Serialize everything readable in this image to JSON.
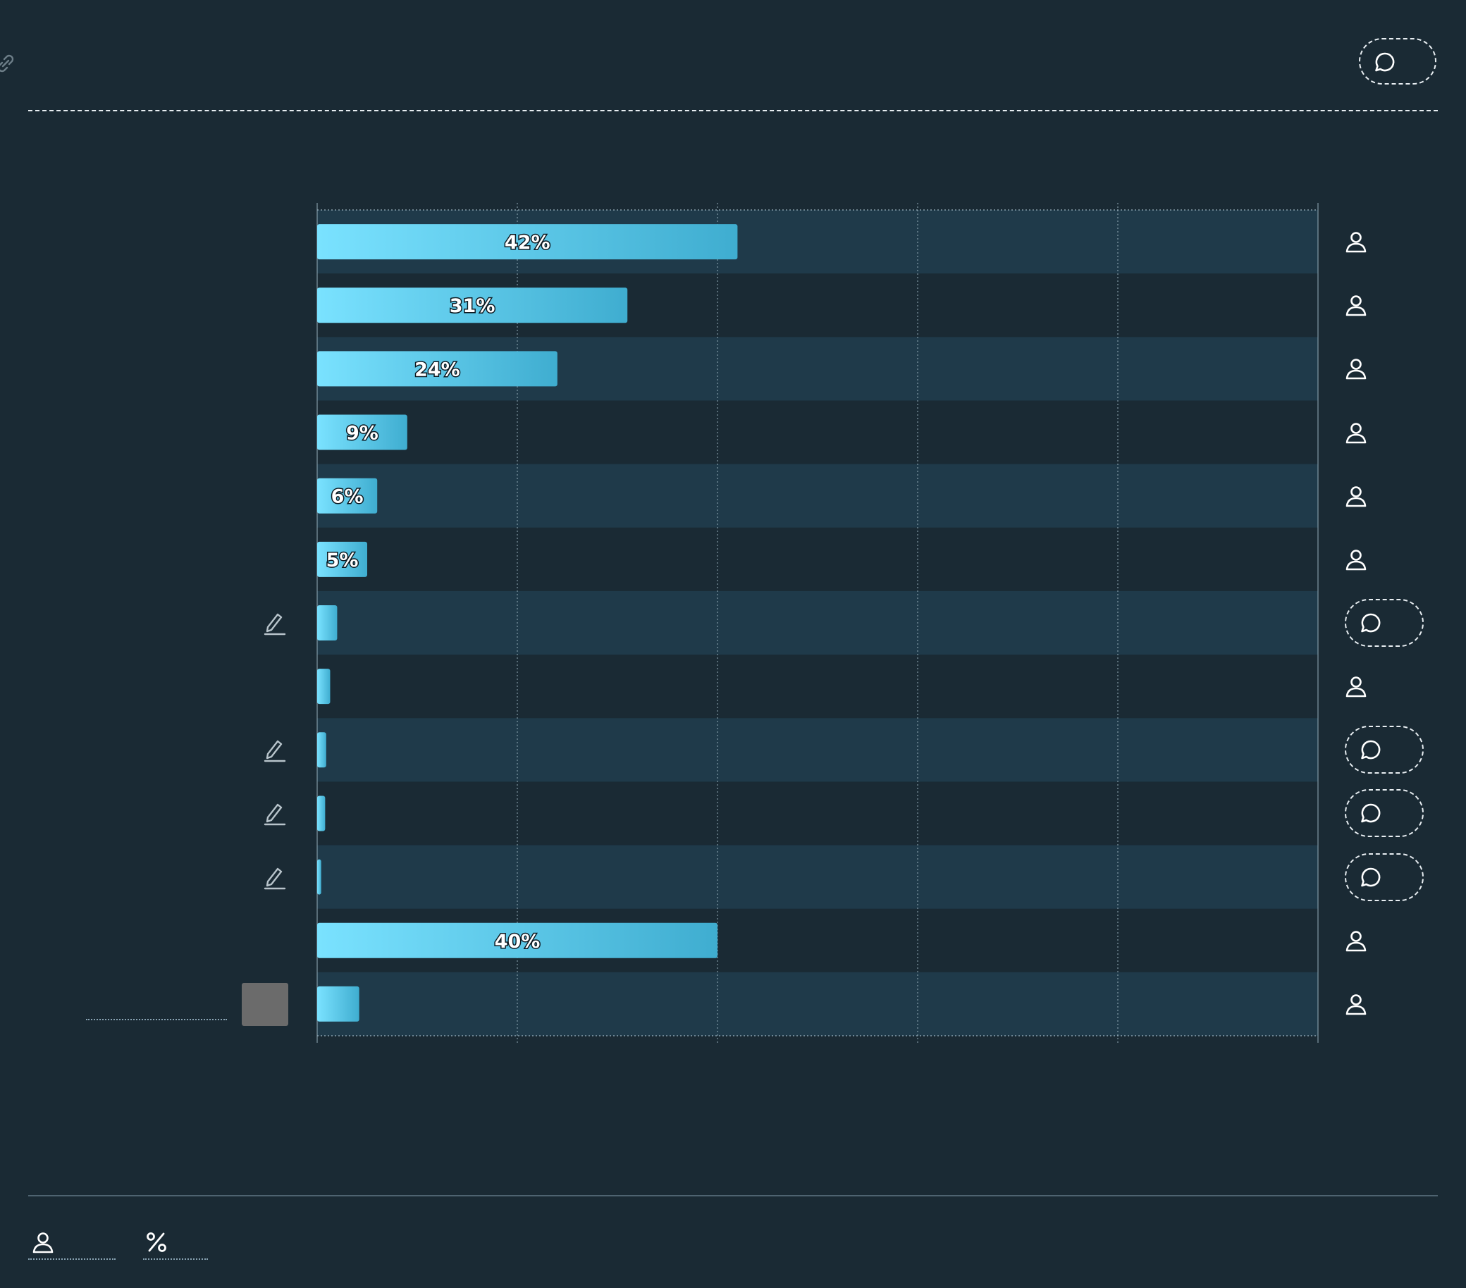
{
  "header": {
    "link_icon": "link-icon",
    "comment_icon": "comment-icon"
  },
  "chart_data": {
    "type": "bar",
    "orientation": "horizontal",
    "values": [
      42,
      31,
      24,
      9,
      6,
      5,
      2,
      1.3,
      0.9,
      0.8,
      0.4,
      40,
      4.2
    ],
    "data_labels": [
      "42%",
      "31%",
      "24%",
      "9%",
      "6%",
      "5%",
      "",
      "",
      "",
      "",
      "",
      "40%",
      ""
    ],
    "row_action_icons": [
      "user-icon",
      "user-icon",
      "user-icon",
      "user-icon",
      "user-icon",
      "user-icon",
      "comment-icon",
      "user-icon",
      "comment-icon",
      "comment-icon",
      "comment-icon",
      "user-icon",
      "user-icon"
    ],
    "row_edit_icons": [
      false,
      false,
      false,
      false,
      false,
      false,
      true,
      false,
      true,
      true,
      true,
      false,
      false
    ],
    "xlim": [
      0,
      100
    ],
    "grid": true,
    "colors": {
      "bar_start": "#7ae2ff",
      "bar_end": "#3fadd0",
      "row_band": "#1f3a4a",
      "background": "#1a2a34"
    }
  },
  "footer": {
    "user_icon": "user-icon",
    "percent_icon": "percent-icon"
  }
}
